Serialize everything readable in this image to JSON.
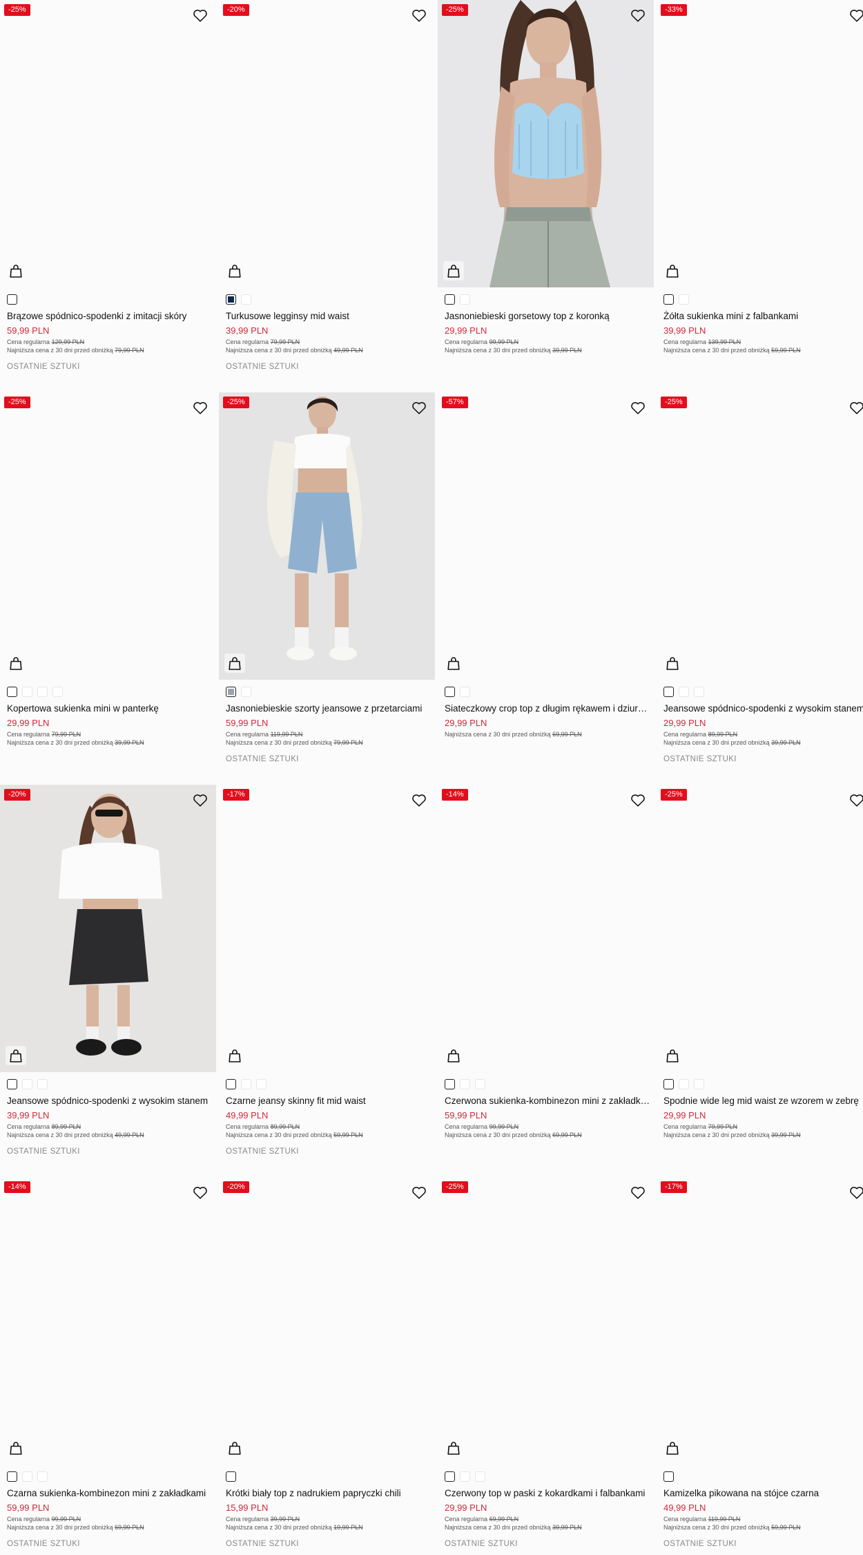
{
  "labels": {
    "regular_prefix": "Cena regularna",
    "lowest_prefix": "Najniższa cena z 30 dni przed obniżką",
    "last_items": "OSTATNIE SZTUKI"
  },
  "colors": {
    "badge": "#e20e1c",
    "price": "#d3283a"
  },
  "products": [
    {
      "discount": "-25%",
      "name": "Brązowe spódnico-spodenki z imitacji skóry",
      "price": "59,99 PLN",
      "regular": "129,99 PLN",
      "lowest": "79,99 PLN",
      "stock": "OSTATNIE SZTUKI"
    },
    {
      "discount": "-20%",
      "name": "Turkusowe legginsy mid waist",
      "price": "39,99 PLN",
      "regular": "79,99 PLN",
      "lowest": "49,99 PLN",
      "stock": "OSTATNIE SZTUKI"
    },
    {
      "discount": "-25%",
      "name": "Jasnoniebieski gorsetowy top z koronką",
      "price": "29,99 PLN",
      "regular": "99,99 PLN",
      "lowest": "39,99 PLN",
      "stock": ""
    },
    {
      "discount": "-33%",
      "name": "Żółta sukienka mini z falbankami",
      "price": "39,99 PLN",
      "regular": "139,99 PLN",
      "lowest": "59,99 PLN",
      "stock": ""
    },
    {
      "discount": "-25%",
      "name": "Kopertowa sukienka mini w panterkę",
      "price": "29,99 PLN",
      "regular": "79,99 PLN",
      "lowest": "39,99 PLN",
      "stock": ""
    },
    {
      "discount": "-25%",
      "name": "Jasnoniebieskie szorty jeansowe z przetarciami",
      "price": "59,99 PLN",
      "regular": "119,99 PLN",
      "lowest": "79,99 PLN",
      "stock": "OSTATNIE SZTUKI"
    },
    {
      "discount": "-57%",
      "name": "Siateczkowy crop top z długim rękawem i dziurami",
      "price": "29,99 PLN",
      "regular": "",
      "lowest": "69,99 PLN",
      "stock": ""
    },
    {
      "discount": "-25%",
      "name": "Jeansowe spódnico-spodenki z wysokim stanem",
      "price": "29,99 PLN",
      "regular": "89,99 PLN",
      "lowest": "39,99 PLN",
      "stock": "OSTATNIE SZTUKI"
    },
    {
      "discount": "-20%",
      "name": "Jeansowe spódnico-spodenki z wysokim stanem",
      "price": "39,99 PLN",
      "regular": "89,99 PLN",
      "lowest": "49,99 PLN",
      "stock": "OSTATNIE SZTUKI"
    },
    {
      "discount": "-17%",
      "name": "Czarne jeansy skinny fit mid waist",
      "price": "49,99 PLN",
      "regular": "89,99 PLN",
      "lowest": "59,99 PLN",
      "stock": "OSTATNIE SZTUKI"
    },
    {
      "discount": "-14%",
      "name": "Czerwona sukienka-kombinezon mini z zakładkami",
      "price": "59,99 PLN",
      "regular": "99,99 PLN",
      "lowest": "69,99 PLN",
      "stock": ""
    },
    {
      "discount": "-25%",
      "name": "Spodnie wide leg mid waist ze wzorem w zebrę",
      "price": "29,99 PLN",
      "regular": "79,99 PLN",
      "lowest": "39,99 PLN",
      "stock": ""
    },
    {
      "discount": "-14%",
      "name": "Czarna sukienka-kombinezon mini z zakładkami",
      "price": "59,99 PLN",
      "regular": "99,99 PLN",
      "lowest": "69,99 PLN",
      "stock": "OSTATNIE SZTUKI"
    },
    {
      "discount": "-20%",
      "name": "Krótki biały top z nadrukiem papryczki chili",
      "price": "15,99 PLN",
      "regular": "39,99 PLN",
      "lowest": "19,99 PLN",
      "stock": "OSTATNIE SZTUKI"
    },
    {
      "discount": "-25%",
      "name": "Czerwony top w paski z kokardkami i falbankami",
      "price": "29,99 PLN",
      "regular": "69,99 PLN",
      "lowest": "39,99 PLN",
      "stock": "OSTATNIE SZTUKI"
    },
    {
      "discount": "-17%",
      "name": "Kamizelka pikowana na stójce czarna",
      "price": "49,99 PLN",
      "regular": "119,99 PLN",
      "lowest": "59,99 PLN",
      "stock": "OSTATNIE SZTUKI"
    }
  ]
}
